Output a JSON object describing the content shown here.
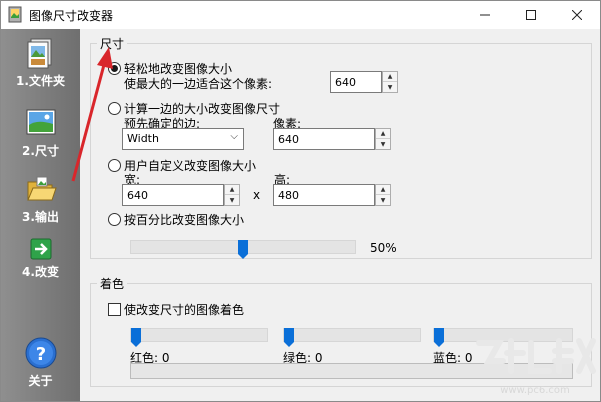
{
  "window": {
    "title": "图像尺寸改变器"
  },
  "titlebar": {
    "min_icon": "minimize-icon",
    "max_icon": "maximize-icon",
    "close_icon": "close-icon"
  },
  "sidebar": {
    "items": [
      {
        "label": "1.文件夹",
        "icon": "folder-images-icon"
      },
      {
        "label": "2.尺寸",
        "icon": "landscape-image-icon"
      },
      {
        "label": "3.输出",
        "icon": "open-folder-icon"
      },
      {
        "label": "4.改变",
        "icon": "green-arrow-icon"
      }
    ],
    "about": {
      "label": "关于",
      "icon": "help-icon"
    }
  },
  "size_group": {
    "legend": "尺寸",
    "option_easy": {
      "label": "轻松地改变图像大小",
      "sub_label": "使最大的一边适合这个像素:",
      "value": "640",
      "checked": true
    },
    "option_one_side": {
      "label": "计算一边的大小改变图像尺寸",
      "side_label": "预先确定的边:",
      "side_value": "Width",
      "pixel_label": "像素:",
      "pixel_value": "640"
    },
    "option_custom": {
      "label": "用户自定义改变图像大小",
      "width_label": "宽:",
      "width_value": "640",
      "x_label": "x",
      "height_label": "高:",
      "height_value": "480"
    },
    "option_percent": {
      "label": "按百分比改变图像大小",
      "percent_text": "50%",
      "percent_value": 0.5
    }
  },
  "color_group": {
    "legend": "着色",
    "checkbox_label": "使改变尺寸的图像着色",
    "red": {
      "label": "红色: 0",
      "value": 0
    },
    "green": {
      "label": "绿色: 0",
      "value": 0
    },
    "blue": {
      "label": "蓝色: 0",
      "value": 0
    }
  },
  "colors": {
    "accent": "#0a6fd8",
    "sidebar": "#7f7f7f",
    "annotation_arrow": "#d9262b"
  }
}
